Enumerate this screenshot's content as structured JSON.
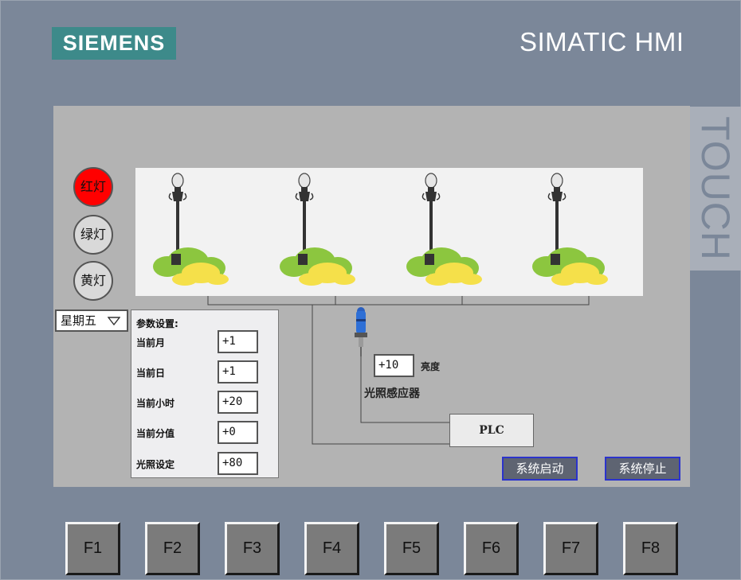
{
  "device": {
    "logo": "SIEMENS",
    "brand": "SIMATIC HMI",
    "touch_label": "TOUCH"
  },
  "lamp_buttons": [
    {
      "label": "红灯",
      "active": true,
      "color": "#ff0000"
    },
    {
      "label": "绿灯",
      "active": false,
      "color": "#d9d9d9"
    },
    {
      "label": "黄灯",
      "active": false,
      "color": "#d9d9d9"
    }
  ],
  "weekday": {
    "value": "星期五"
  },
  "params": {
    "title": "参数设置:",
    "items": [
      {
        "label": "当前月",
        "value": "+1"
      },
      {
        "label": "当前日",
        "value": "+1"
      },
      {
        "label": "当前小时",
        "value": "+20"
      },
      {
        "label": "当前分值",
        "value": "+0"
      },
      {
        "label": "光照设定",
        "value": "+80"
      }
    ]
  },
  "sensor": {
    "brightness_value": "+10",
    "brightness_label": "亮度",
    "name": "光照感应器"
  },
  "plc_label": "PLC",
  "system_buttons": {
    "start": "系统启动",
    "stop": "系统停止"
  },
  "function_keys": [
    "F1",
    "F2",
    "F3",
    "F4",
    "F5",
    "F6",
    "F7",
    "F8"
  ],
  "colors": {
    "bezel": "#7b8799",
    "screen": "#b3b3b3",
    "logo_bg": "#3d8a8a",
    "bush_green": "#8cc63f",
    "bush_yellow": "#f5e04a",
    "button_border": "#2b33cc"
  }
}
